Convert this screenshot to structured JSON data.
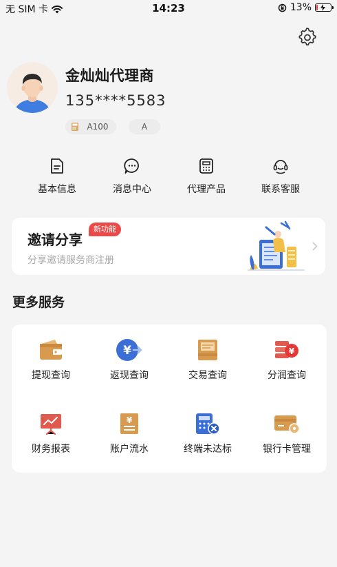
{
  "status_bar": {
    "carrier": "无 SIM 卡",
    "time": "14:23",
    "battery": "13%",
    "battery_level": 0.13
  },
  "profile": {
    "name": "金灿灿代理商",
    "phone": "135****5583",
    "level_tag": "A100",
    "grade_tag": "A"
  },
  "quick_actions": [
    {
      "label": "基本信息",
      "icon": "document-icon"
    },
    {
      "label": "消息中心",
      "icon": "chat-bubble-icon"
    },
    {
      "label": "代理产品",
      "icon": "pos-terminal-icon"
    },
    {
      "label": "联系客服",
      "icon": "headset-icon"
    }
  ],
  "invite": {
    "title": "邀请分享",
    "badge": "新功能",
    "subtitle": "分享邀请服务商注册"
  },
  "more_services": {
    "title": "更多服务",
    "items": [
      {
        "label": "提现查询",
        "icon": "wallet-icon"
      },
      {
        "label": "返现查询",
        "icon": "yuan-coin-icon"
      },
      {
        "label": "交易查询",
        "icon": "ledger-icon"
      },
      {
        "label": "分润查询",
        "icon": "coins-stack-icon"
      },
      {
        "label": "财务报表",
        "icon": "report-board-icon"
      },
      {
        "label": "账户流水",
        "icon": "bill-icon"
      },
      {
        "label": "终端未达标",
        "icon": "calculator-icon"
      },
      {
        "label": "银行卡管理",
        "icon": "bank-card-icon"
      }
    ]
  },
  "colors": {
    "accent_red": "#ea4b48",
    "gold": "#d9a25a",
    "blue": "#3b6fd6",
    "page_bg": "#f4f4f5"
  }
}
